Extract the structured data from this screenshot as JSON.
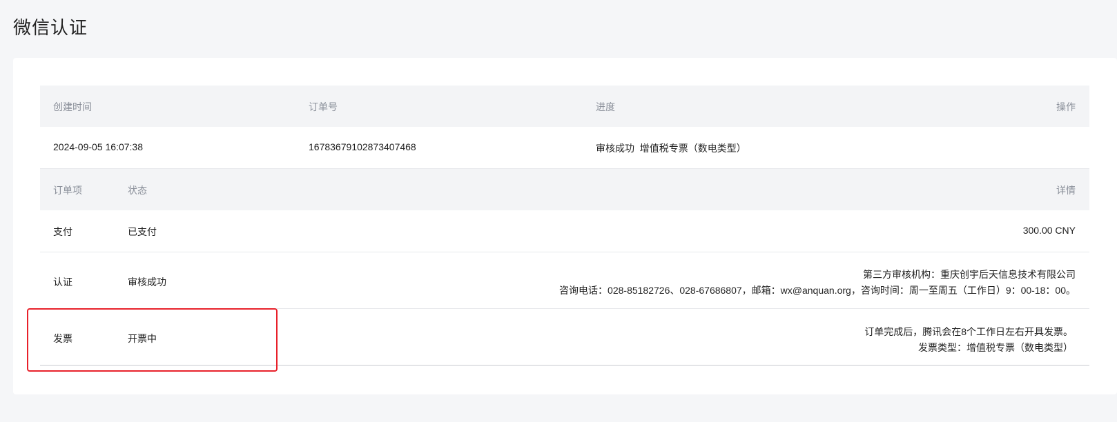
{
  "page": {
    "title": "微信认证"
  },
  "order_header": {
    "created_time_label": "创建时间",
    "order_no_label": "订单号",
    "progress_label": "进度",
    "action_label": "操作"
  },
  "order": {
    "created_time": "2024-09-05 16:07:38",
    "order_no": "16783679102873407468",
    "progress": "审核成功  增值税专票（数电类型）"
  },
  "items_header": {
    "item_label": "订单项",
    "status_label": "状态",
    "detail_label": "详情"
  },
  "items": [
    {
      "name": "支付",
      "status": "已支付",
      "detail_lines": [
        "300.00 CNY"
      ]
    },
    {
      "name": "认证",
      "status": "审核成功",
      "detail_lines": [
        "第三方审核机构：重庆创宇后天信息技术有限公司",
        "咨询电话：028-85182726、028-67686807，邮箱：wx@anquan.org，咨询时间：周一至周五（工作日）9：00-18：00。"
      ]
    },
    {
      "name": "发票",
      "status": "开票中",
      "detail_lines": [
        "订单完成后，腾讯会在8个工作日左右开具发票。",
        "发票类型：增值税专票（数电类型）"
      ]
    }
  ],
  "colors": {
    "background": "#f5f6f8",
    "header_row": "#f3f4f6",
    "highlight_border": "#e8202a"
  }
}
